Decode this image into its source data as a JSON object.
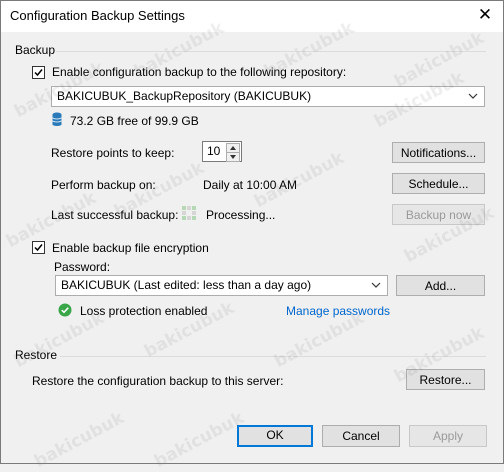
{
  "window": {
    "title": "Configuration Backup Settings",
    "close_icon": "close-icon"
  },
  "backup": {
    "group_label": "Backup",
    "enable_checkbox": {
      "checked": true,
      "label": "Enable configuration backup to the following repository:"
    },
    "repository": {
      "selected": "BAKICUBUK_BackupRepository (BAKICUBUK)"
    },
    "storage_text": "73.2 GB free of 99.9 GB",
    "restore_points": {
      "label": "Restore points to keep:",
      "value": "10"
    },
    "notifications_button": "Notifications...",
    "schedule": {
      "label": "Perform backup on:",
      "value": "Daily at 10:00 AM",
      "button": "Schedule..."
    },
    "last_backup": {
      "label": "Last successful backup:",
      "value": "Processing...",
      "button": "Backup now"
    },
    "encryption": {
      "checked": true,
      "label": "Enable backup file encryption",
      "password_label": "Password:",
      "password_selected": "BAKICUBUK (Last edited: less than a day ago)",
      "add_button": "Add...",
      "loss_protection_text": "Loss protection enabled",
      "manage_link": "Manage passwords"
    }
  },
  "restore": {
    "group_label": "Restore",
    "description": "Restore the configuration backup to this server:",
    "button": "Restore..."
  },
  "footer": {
    "ok": "OK",
    "cancel": "Cancel",
    "apply": "Apply"
  },
  "watermark": "bakicubuk",
  "colors": {
    "accent": "#0078d7",
    "link": "#0066cc",
    "success": "#3aa64a",
    "db_icon": "#2a7ab9"
  }
}
